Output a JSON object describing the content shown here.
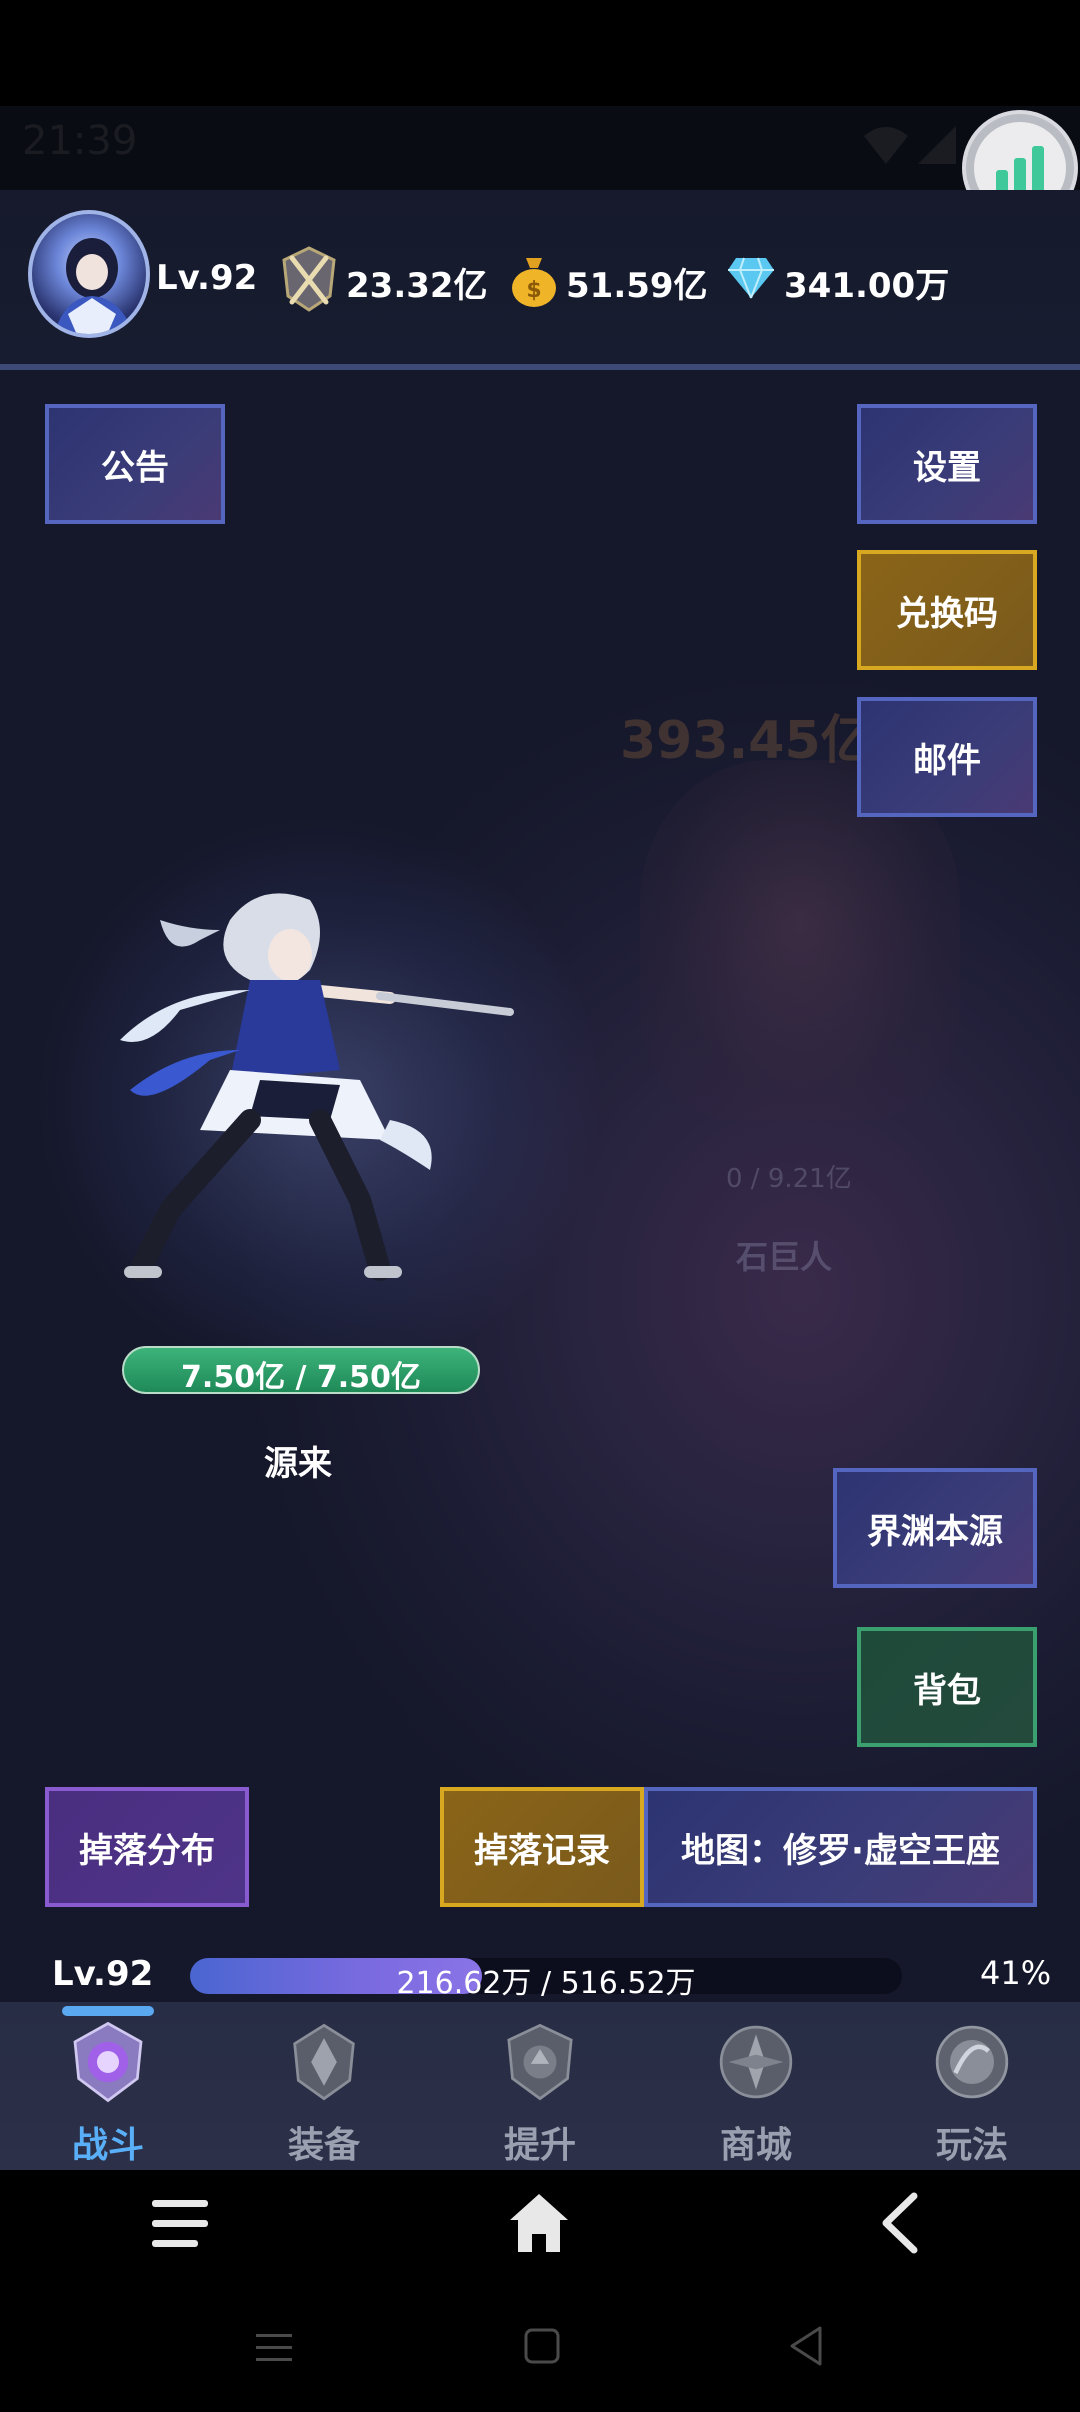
{
  "status_bar": {
    "time": "21:39"
  },
  "header": {
    "level": "Lv.92",
    "power": "23.32亿",
    "gold": "51.59亿",
    "diamond": "341.00万"
  },
  "buttons": {
    "notice": "公告",
    "settings": "设置",
    "redeem": "兑换码",
    "mail": "邮件",
    "abyss": "界渊本源",
    "bag": "背包",
    "drops": "掉落分布",
    "drop_log": "掉落记录",
    "map": "地图：修罗·虚空王座"
  },
  "battle": {
    "hero_hp": "7.50亿 / 7.50亿",
    "hero_name": "源来",
    "enemy_damage": "393.45亿",
    "enemy_hp": "0 / 9.21亿",
    "enemy_name": "石巨人"
  },
  "exp": {
    "level": "Lv.92",
    "text": "216.62万 / 516.52万",
    "percent_label": "41%",
    "fraction": 0.41
  },
  "nav": {
    "items": [
      {
        "label": "战斗",
        "icon": "battle-emblem-icon",
        "active": true
      },
      {
        "label": "装备",
        "icon": "equipment-emblem-icon",
        "active": false
      },
      {
        "label": "提升",
        "icon": "upgrade-emblem-icon",
        "active": false
      },
      {
        "label": "商城",
        "icon": "shop-emblem-icon",
        "active": false
      },
      {
        "label": "玩法",
        "icon": "gameplay-emblem-icon",
        "active": false
      }
    ]
  },
  "colors": {
    "accent_blue": "#5ab0f8",
    "hp_green": "#2fa06a",
    "button_gold": "#d8a820",
    "button_blue": "#5566c0"
  }
}
